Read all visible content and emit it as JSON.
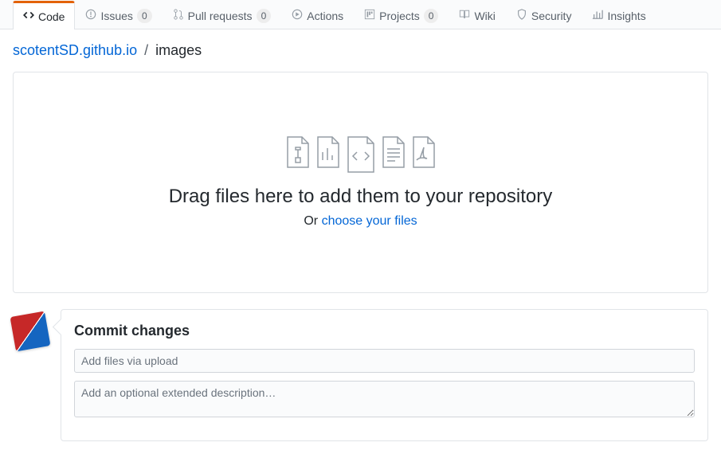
{
  "tabs": [
    {
      "label": "Code",
      "count": null
    },
    {
      "label": "Issues",
      "count": "0"
    },
    {
      "label": "Pull requests",
      "count": "0"
    },
    {
      "label": "Actions",
      "count": null
    },
    {
      "label": "Projects",
      "count": "0"
    },
    {
      "label": "Wiki",
      "count": null
    },
    {
      "label": "Security",
      "count": null
    },
    {
      "label": "Insights",
      "count": null
    }
  ],
  "breadcrumb": {
    "repo": "scotentSD.github.io",
    "sep": "/",
    "folder": "images"
  },
  "dropzone": {
    "title": "Drag files here to add them to your repository",
    "or": "Or ",
    "choose": "choose your files"
  },
  "commit": {
    "heading": "Commit changes",
    "summary_placeholder": "Add files via upload",
    "description_placeholder": "Add an optional extended description…"
  }
}
